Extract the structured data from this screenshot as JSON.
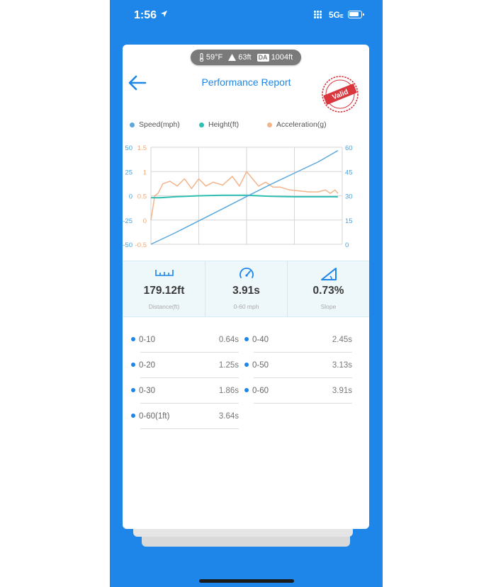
{
  "status_bar": {
    "time": "1:56",
    "network": "5G",
    "network_suffix": "E"
  },
  "conditions": {
    "temperature": "59°F",
    "altitude": "63ft",
    "da_badge": "DA",
    "density_altitude": "1004ft"
  },
  "header": {
    "title": "Performance Report",
    "stamp_text": "Valid"
  },
  "colors": {
    "brand": "#1d86e8",
    "speed": "#5aa7e0",
    "height": "#2fbfb2",
    "acceleration": "#f2b48a"
  },
  "chart_data": {
    "type": "line",
    "legend": [
      "Speed(mph)",
      "Height(ft)",
      "Acceleration(g)"
    ],
    "left_axis_height": {
      "ticks": [
        "50",
        "25",
        "0",
        "-25",
        "-50"
      ],
      "range": [
        -50,
        50
      ]
    },
    "left_axis_acceleration": {
      "ticks": [
        "1.5",
        "1",
        "0.5",
        "0",
        "-0.5"
      ],
      "range": [
        -0.5,
        1.5
      ]
    },
    "right_axis_speed": {
      "ticks": [
        "60",
        "45",
        "30",
        "15",
        "0"
      ],
      "range": [
        0,
        60
      ]
    },
    "grid": true,
    "x_domain": [
      0,
      4
    ],
    "series": [
      {
        "name": "Speed(mph)",
        "axis": "right",
        "x": [
          0,
          0.5,
          1,
          1.5,
          2,
          2.5,
          3,
          3.5,
          3.91
        ],
        "values": [
          0,
          7,
          14.5,
          22,
          29.5,
          37,
          44,
          51,
          58
        ]
      },
      {
        "name": "Height(ft)",
        "axis": "left",
        "x": [
          0,
          0.2,
          0.5,
          1,
          1.5,
          2,
          2.5,
          3,
          3.5,
          3.91
        ],
        "values": [
          -2,
          -2,
          -1,
          0,
          0.5,
          0.5,
          -0.5,
          -1,
          -1,
          -1
        ]
      },
      {
        "name": "Acceleration(g)",
        "axis": "left2",
        "x": [
          0,
          0.08,
          0.15,
          0.25,
          0.4,
          0.55,
          0.7,
          0.85,
          1,
          1.15,
          1.3,
          1.5,
          1.7,
          1.85,
          2.0,
          2.25,
          2.4,
          2.55,
          2.7,
          2.9,
          3.1,
          3.3,
          3.5,
          3.65,
          3.75,
          3.85,
          3.91
        ],
        "values": [
          0.0,
          0.5,
          0.55,
          0.75,
          0.8,
          0.7,
          0.85,
          0.65,
          0.85,
          0.7,
          0.78,
          0.72,
          0.9,
          0.7,
          1.0,
          0.7,
          0.78,
          0.68,
          0.68,
          0.62,
          0.6,
          0.58,
          0.58,
          0.62,
          0.55,
          0.62,
          0.55
        ]
      }
    ]
  },
  "metrics": [
    {
      "icon": "ruler-icon",
      "value": "179.12ft",
      "label": "Distance(ft)"
    },
    {
      "icon": "speedometer-icon",
      "value": "3.91s",
      "label": "0-60 mph"
    },
    {
      "icon": "slope-icon",
      "value": "0.73%",
      "label": "Slope"
    }
  ],
  "splits": [
    {
      "label": "0-10",
      "time": "0.64s"
    },
    {
      "label": "0-40",
      "time": "2.45s"
    },
    {
      "label": "0-20",
      "time": "1.25s"
    },
    {
      "label": "0-50",
      "time": "3.13s"
    },
    {
      "label": "0-30",
      "time": "1.86s"
    },
    {
      "label": "0-60",
      "time": "3.91s"
    },
    {
      "label": "0-60(1ft)",
      "time": "3.64s"
    }
  ]
}
